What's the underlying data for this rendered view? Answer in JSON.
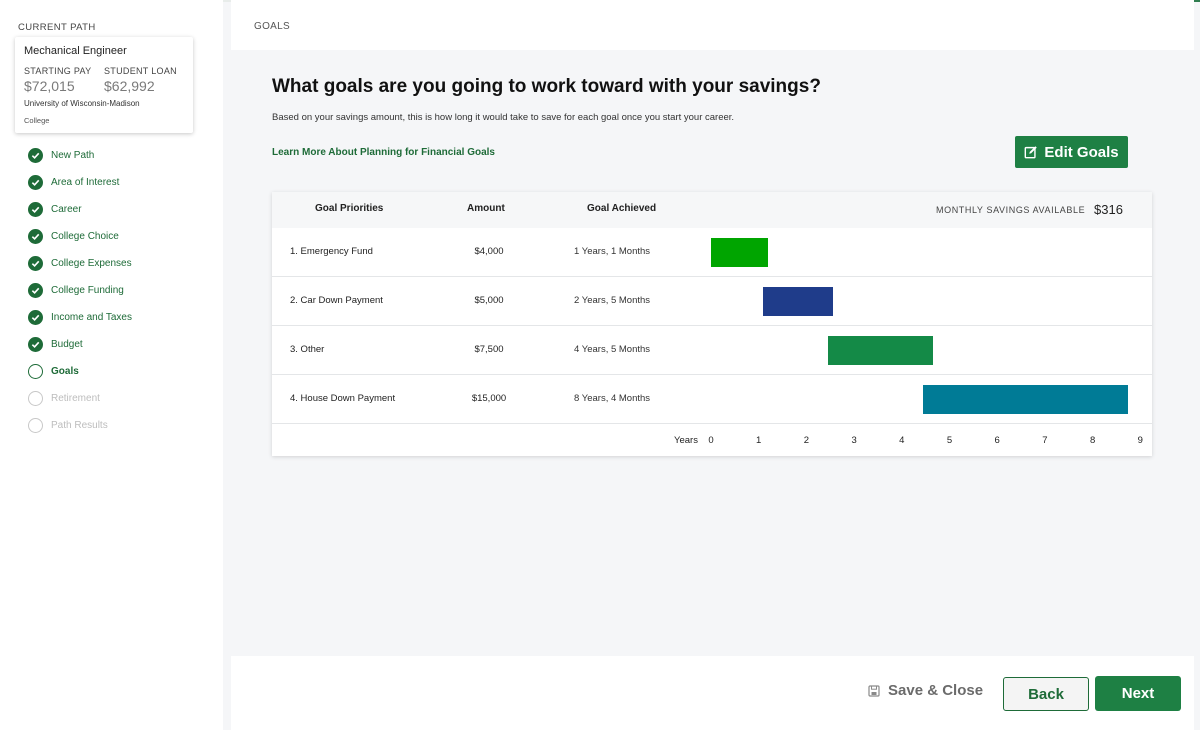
{
  "sidebar": {
    "current_path_label": "CURRENT PATH",
    "path_card": {
      "title": "Mechanical Engineer",
      "starting_pay_label": "STARTING PAY",
      "starting_pay_value": "$72,015",
      "student_loan_label": "STUDENT LOAN",
      "student_loan_value": "$62,992",
      "school": "University of Wisconsin-Madison",
      "school_type": "College"
    },
    "steps": [
      {
        "label": "New Path",
        "status": "done"
      },
      {
        "label": "Area of Interest",
        "status": "done"
      },
      {
        "label": "Career",
        "status": "done"
      },
      {
        "label": "College Choice",
        "status": "done"
      },
      {
        "label": "College Expenses",
        "status": "done"
      },
      {
        "label": "College Funding",
        "status": "done"
      },
      {
        "label": "Income and Taxes",
        "status": "done"
      },
      {
        "label": "Budget",
        "status": "done"
      },
      {
        "label": "Goals",
        "status": "current"
      },
      {
        "label": "Retirement",
        "status": "todo"
      },
      {
        "label": "Path Results",
        "status": "todo"
      }
    ]
  },
  "header": {
    "breadcrumb": "GOALS"
  },
  "main": {
    "title": "What goals are you going to work toward with your savings?",
    "subtitle": "Based on your savings amount, this is how long it would take to save for each goal once you start your career.",
    "learn_more_link": "Learn More About Planning for Financial Goals",
    "edit_goals_label": "Edit Goals"
  },
  "goals_table": {
    "headers": {
      "priorities": "Goal Priorities",
      "amount": "Amount",
      "achieved": "Goal Achieved"
    },
    "monthly_savings_label": "MONTHLY SAVINGS AVAILABLE",
    "monthly_savings_value": "$316",
    "colors": {
      "bar1": "#00a500",
      "bar2": "#1f3c8a",
      "bar3": "#148a47",
      "bar4": "#007b96"
    },
    "rows": [
      {
        "name": "1. Emergency Fund",
        "amount": "$4,000",
        "achieved": "1 Years, 1 Months"
      },
      {
        "name": "2. Car Down Payment",
        "amount": "$5,000",
        "achieved": "2 Years, 5 Months"
      },
      {
        "name": "3. Other",
        "amount": "$7,500",
        "achieved": "4 Years, 5 Months"
      },
      {
        "name": "4. House Down Payment",
        "amount": "$15,000",
        "achieved": "8 Years, 4 Months"
      }
    ],
    "axis_label": "Years",
    "ticks": [
      "0",
      "1",
      "2",
      "3",
      "4",
      "5",
      "6",
      "7",
      "8",
      "9"
    ]
  },
  "chart_data": {
    "type": "bar",
    "orientation": "horizontal-timeline",
    "categories": [
      "1. Emergency Fund",
      "2. Car Down Payment",
      "3. Other",
      "4. House Down Payment"
    ],
    "series": [
      {
        "start": [
          0,
          1.1,
          2.45,
          4.45
        ],
        "end": [
          1.2,
          2.55,
          4.65,
          8.75
        ]
      }
    ],
    "xlabel": "Years",
    "xlim": [
      0,
      9
    ]
  },
  "footer": {
    "save_close_label": "Save & Close",
    "back_label": "Back",
    "next_label": "Next"
  }
}
